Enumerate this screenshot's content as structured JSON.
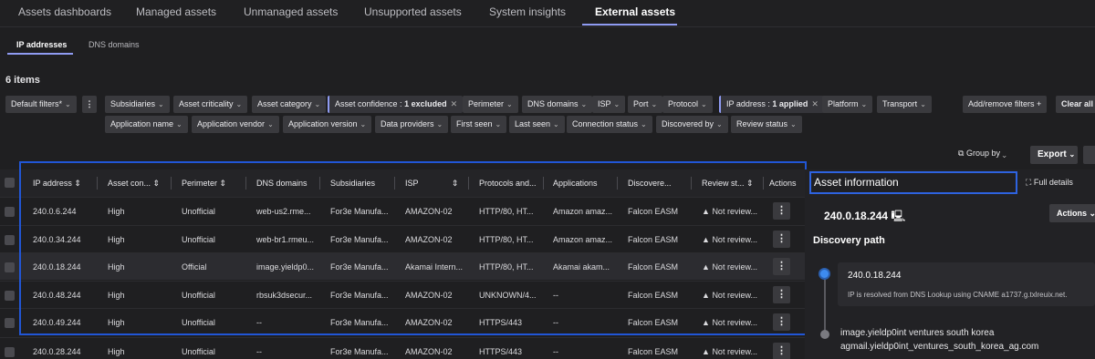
{
  "top_tabs": [
    "Assets dashboards",
    "Managed assets",
    "Unmanaged assets",
    "Unsupported assets",
    "System insights",
    "External assets"
  ],
  "sub_tabs": [
    "IP addresses",
    "DNS domains"
  ],
  "item_count": "6 items",
  "filters_row1": [
    "Default filters*",
    "Subsidiaries",
    "Asset criticality",
    "Asset category",
    "Perimeter",
    "DNS domains",
    "ISP",
    "Port",
    "Protocol",
    "Platform",
    "Transport"
  ],
  "applied_filters": {
    "confidence_label": "Asset confidence :",
    "confidence_value": "1 excluded",
    "ip_label": "IP address :",
    "ip_value": "1 applied"
  },
  "filters_row2": [
    "Application name",
    "Application vendor",
    "Application version",
    "Data providers",
    "First seen",
    "Last seen",
    "Connection status",
    "Discovered by",
    "Review status"
  ],
  "toolbar": {
    "add_remove": "Add/remove filters",
    "clear_all": "Clear all",
    "group_by": "Group by",
    "export": "Export"
  },
  "columns": [
    "IP address",
    "Asset con...",
    "Perimeter",
    "DNS domains",
    "Subsidiaries",
    "ISP",
    "Protocols and...",
    "Applications",
    "Discovere...",
    "Review st...",
    "Actions"
  ],
  "rows": [
    [
      "240.0.6.244",
      "High",
      "Unofficial",
      "web-us2.rme...",
      "For3e Manufa...",
      "AMAZON-02",
      "HTTP/80, HT...",
      "Amazon amaz...",
      "Falcon EASM",
      "Not review..."
    ],
    [
      "240.0.34.244",
      "High",
      "Unofficial",
      "web-br1.rmeu...",
      "For3e Manufa...",
      "AMAZON-02",
      "HTTP/80, HT...",
      "Amazon amaz...",
      "Falcon EASM",
      "Not review..."
    ],
    [
      "240.0.18.244",
      "High",
      "Official",
      "image.yieldp0...",
      "For3e Manufa...",
      "Akamai Intern...",
      "HTTP/80, HT...",
      "Akamai akam...",
      "Falcon EASM",
      "Not review..."
    ],
    [
      "240.0.48.244",
      "High",
      "Unofficial",
      "rbsuk3dsecur...",
      "For3e Manufa...",
      "AMAZON-02",
      "UNKNOWN/4...",
      "--",
      "Falcon EASM",
      "Not review..."
    ],
    [
      "240.0.49.244",
      "High",
      "Unofficial",
      "--",
      "For3e Manufa...",
      "AMAZON-02",
      "HTTPS/443",
      "--",
      "Falcon EASM",
      "Not review..."
    ],
    [
      "240.0.28.244",
      "High",
      "Unofficial",
      "--",
      "For3e Manufa...",
      "AMAZON-02",
      "HTTPS/443",
      "--",
      "Falcon EASM",
      "Not review..."
    ]
  ],
  "panel": {
    "title": "Asset information",
    "full_details": "Full details",
    "ip": "240.0.18.244",
    "actions": "Actions",
    "discovery_path": "Discovery path",
    "path_ip": "240.0.18.244",
    "path_desc": "IP is resolved from DNS Lookup using CNAME a1737.g.txlreuix.net.",
    "chain_text": "image.yieldp0int ventures south korea agmail.yieldp0int_ventures_south_korea_ag.com"
  },
  "colors": {
    "accent": "#8f9bf2",
    "highlight_border": "#2156d6",
    "timeline_dot": "#3d8bf0"
  }
}
